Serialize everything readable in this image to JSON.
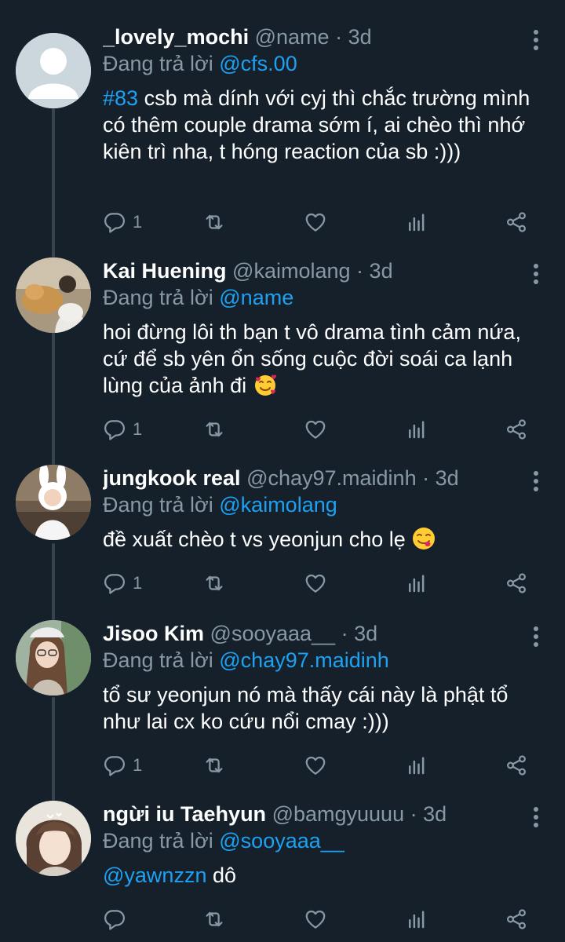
{
  "tweets": [
    {
      "name": "_lovely_mochi",
      "handle": "@name",
      "dot": "·",
      "time": "3d",
      "reply_prefix": "Đang trả lời ",
      "reply_to": "@cfs.00",
      "hashtag": "#83",
      "text": " csb mà dính với cyj thì chắc trường mình có thêm couple drama sớm í, ai chèo thì nhớ kiên trì nha, t hóng reaction của sb :)))",
      "reply_count": "1"
    },
    {
      "name": "Kai Huening",
      "handle": "@kaimolang",
      "dot": "·",
      "time": "3d",
      "reply_prefix": "Đang trả lời ",
      "reply_to": "@name",
      "text": "hoi đừng lôi th bạn t vô drama tình cảm nứa, cứ để sb yên ổn sống cuộc đời soái ca lạnh lùng của ảnh đi",
      "emoji": "smiling-face-with-hearts",
      "reply_count": "1"
    },
    {
      "name": "jungkook real",
      "handle": "@chay97.maidinh",
      "dot": "·",
      "time": "3d",
      "reply_prefix": "Đang trả lời ",
      "reply_to": "@kaimolang",
      "text": "đề xuất chèo t vs yeonjun cho lẹ",
      "emoji": "face-savoring-food",
      "reply_count": "1"
    },
    {
      "name": "Jisoo Kim",
      "handle": "@sooyaaa__",
      "dot": "·",
      "time": "3d",
      "reply_prefix": "Đang trả lời ",
      "reply_to": "@chay97.maidinh",
      "text": "tổ sư yeonjun nó mà thấy cái này  là phật tổ như lai cx ko cứu nổi cmay :)))",
      "reply_count": "1"
    },
    {
      "name": "ngừi iu Taehyun",
      "handle": "@bamgyuuuu",
      "dot": "·",
      "time": "3d",
      "reply_prefix": "Đang trả lời ",
      "reply_to": "@sooyaaa__",
      "mention": "@yawnzzn",
      "text": " dô",
      "reply_count": ""
    }
  ],
  "icons": {
    "reply": "reply-icon",
    "retweet": "retweet-icon",
    "like": "heart-icon",
    "analytics": "analytics-icon",
    "share": "share-icon",
    "more": "more-vertical-icon"
  },
  "colors": {
    "background": "#15202b",
    "text": "#ffffff",
    "secondary": "#8899a6",
    "link": "#1da1f2",
    "thread_line": "#38444d"
  }
}
